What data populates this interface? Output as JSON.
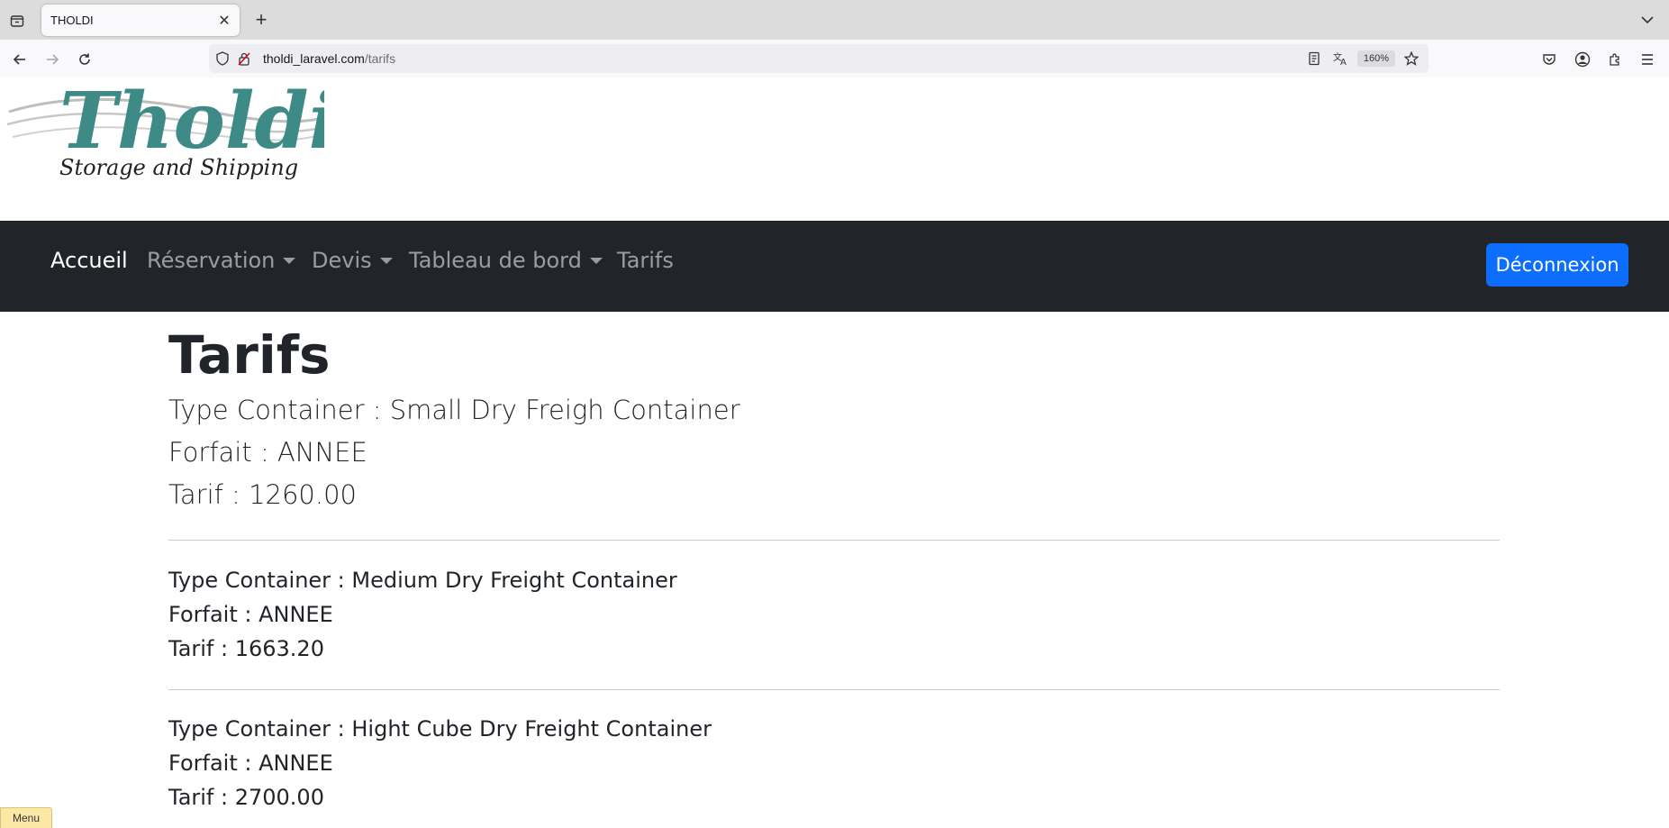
{
  "browser": {
    "tab_title": "THOLDI",
    "url_host": "tholdi_laravel.com",
    "url_path": "/tarifs",
    "zoom": "160%"
  },
  "site": {
    "logo_text": "Tholdi",
    "logo_tagline": "Storage and Shipping",
    "nav": {
      "items": [
        {
          "label": "Accueil",
          "active": true
        },
        {
          "label": "Réservation",
          "dropdown": true
        },
        {
          "label": "Devis",
          "dropdown": true
        },
        {
          "label": "Tableau de bord",
          "dropdown": true
        },
        {
          "label": "Tarifs"
        }
      ],
      "logout_label": "Déconnexion"
    }
  },
  "main": {
    "title": "Tarifs",
    "tarifs": [
      {
        "type": "Type Container : Small Dry Freigh Container",
        "forfait": "Forfait : ANNEE",
        "tarif": "Tarif : 1260.00"
      },
      {
        "type": "Type Container : Medium Dry Freight Container",
        "forfait": "Forfait : ANNEE",
        "tarif": "Tarif : 1663.20"
      },
      {
        "type": "Type Container : Hight Cube Dry Freight Container",
        "forfait": "Forfait : ANNEE",
        "tarif": "Tarif : 2700.00"
      }
    ]
  },
  "overlay": {
    "menu_label": "Menu"
  },
  "colors": {
    "navbar_bg": "#212529",
    "primary": "#0d6efd",
    "logo_teal": "#3d8a86"
  }
}
